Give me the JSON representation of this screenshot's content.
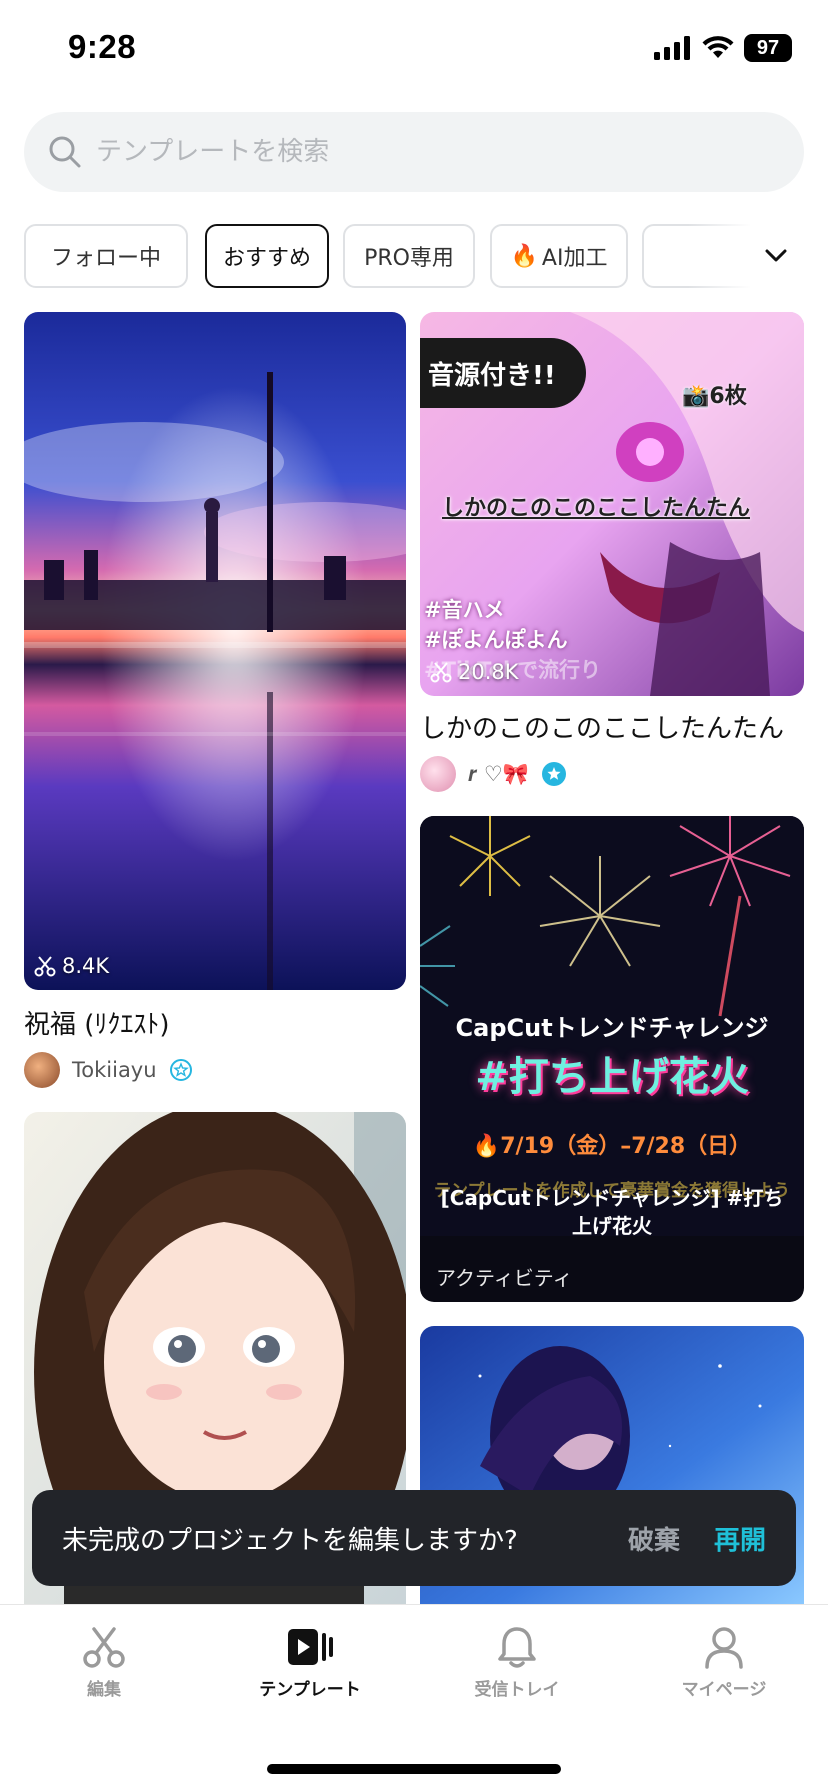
{
  "status": {
    "time": "9:28",
    "battery": "97"
  },
  "search": {
    "placeholder": "テンプレートを検索"
  },
  "chips": [
    {
      "label": "フォロー中"
    },
    {
      "label": "おすすめ"
    },
    {
      "label": "PRO専用"
    },
    {
      "label": "AI加工"
    }
  ],
  "cards": {
    "c1": {
      "title": "祝福 (ﾘｸｴｽﾄ)",
      "author": "Tokiiayu",
      "uses": "8.4K"
    },
    "c2": {
      "title": "しかのこのこのここしたんたん",
      "author": "𝒓 ♡🎀",
      "uses": "20.8K",
      "badge": "音源付き!!",
      "photo_count": "📸6枚",
      "overlay_title": "しかのこのこのここしたんたん",
      "tag1": "#音ハメ",
      "tag2": "#ぽよんぽよん",
      "tag3": "#TikTokで流行り"
    },
    "c3": {
      "headline": "CapCutトレンドチャレンジ",
      "hashtag": "#打ち上げ花火",
      "dates": "🔥7/19（金）–7/28（日）",
      "desc1": "テンプレートを作成して豪華賞金を獲得しよう",
      "desc2": "[CapCutトレンドチャレンジ] #打ち上げ花火",
      "label": "アクティビティ"
    }
  },
  "toast": {
    "message": "未完成のプロジェクトを編集しますか?",
    "discard": "破棄",
    "resume": "再開"
  },
  "tabs": [
    {
      "label": "編集"
    },
    {
      "label": "テンプレート"
    },
    {
      "label": "受信トレイ"
    },
    {
      "label": "マイページ"
    }
  ],
  "colors": {
    "accent": "#1fc0d8",
    "verified": "#26b6e0"
  }
}
